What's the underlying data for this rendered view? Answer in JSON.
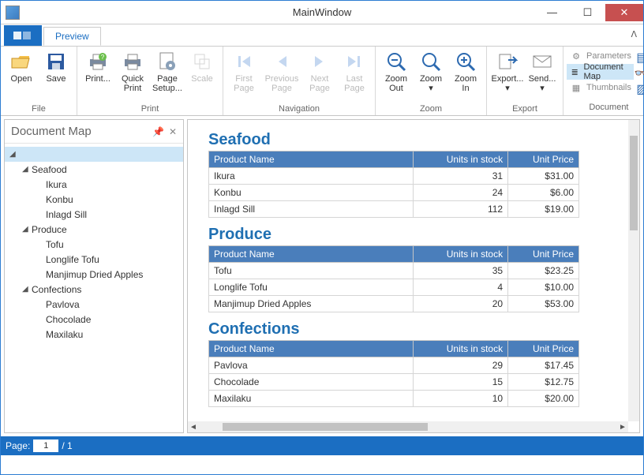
{
  "window": {
    "title": "MainWindow"
  },
  "tabs": {
    "preview": "Preview"
  },
  "ribbon": {
    "file": {
      "label": "File",
      "open": "Open",
      "save": "Save"
    },
    "print": {
      "label": "Print",
      "print": "Print...",
      "quick": "Quick\nPrint",
      "setup": "Page\nSetup...",
      "scale": "Scale"
    },
    "nav": {
      "label": "Navigation",
      "first": "First\nPage",
      "prev": "Previous\nPage",
      "next": "Next\nPage",
      "last": "Last\nPage"
    },
    "zoom": {
      "label": "Zoom",
      "out": "Zoom\nOut",
      "zoom": "Zoom",
      "in": "Zoom\nIn"
    },
    "export": {
      "label": "Export",
      "export": "Export...",
      "send": "Send..."
    },
    "doc": {
      "label": "Document",
      "params": "Parameters",
      "docmap": "Document Map",
      "thumbs": "Thumbnails"
    }
  },
  "docmap": {
    "title": "Document Map",
    "root": "",
    "groups": [
      {
        "name": "Seafood",
        "items": [
          "Ikura",
          "Konbu",
          "Inlagd Sill"
        ]
      },
      {
        "name": "Produce",
        "items": [
          "Tofu",
          "Longlife Tofu",
          "Manjimup Dried Apples"
        ]
      },
      {
        "name": "Confections",
        "items": [
          "Pavlova",
          "Chocolade",
          "Maxilaku"
        ]
      }
    ]
  },
  "report": {
    "columns": [
      "Product Name",
      "Units in stock",
      "Unit Price"
    ],
    "sections": [
      {
        "title": "Seafood",
        "rows": [
          {
            "name": "Ikura",
            "units": 31,
            "price": "$31.00"
          },
          {
            "name": "Konbu",
            "units": 24,
            "price": "$6.00"
          },
          {
            "name": "Inlagd Sill",
            "units": 112,
            "price": "$19.00"
          }
        ]
      },
      {
        "title": "Produce",
        "rows": [
          {
            "name": "Tofu",
            "units": 35,
            "price": "$23.25"
          },
          {
            "name": "Longlife Tofu",
            "units": 4,
            "price": "$10.00"
          },
          {
            "name": "Manjimup Dried Apples",
            "units": 20,
            "price": "$53.00"
          }
        ]
      },
      {
        "title": "Confections",
        "rows": [
          {
            "name": "Pavlova",
            "units": 29,
            "price": "$17.45"
          },
          {
            "name": "Chocolade",
            "units": 15,
            "price": "$12.75"
          },
          {
            "name": "Maxilaku",
            "units": 10,
            "price": "$20.00"
          }
        ]
      }
    ]
  },
  "status": {
    "page_label": "Page:",
    "page": "1",
    "total": "/ 1"
  }
}
